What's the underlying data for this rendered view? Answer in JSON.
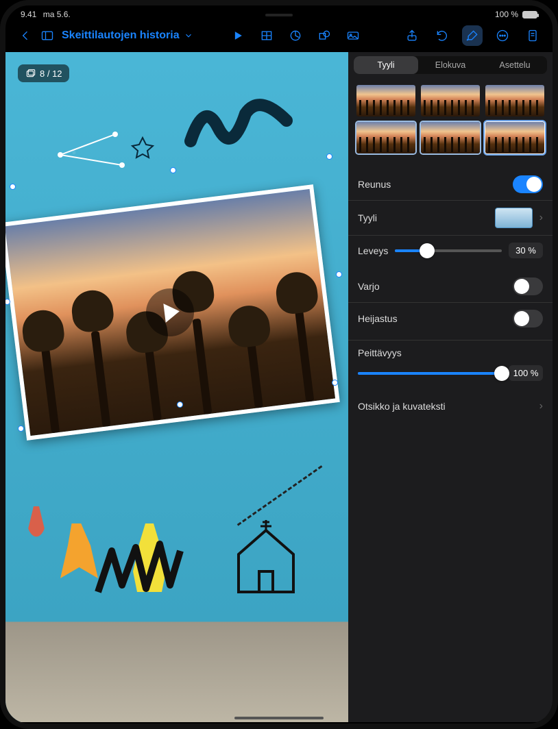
{
  "status": {
    "time": "9.41",
    "date": "ma 5.6.",
    "battery_pct": "100 %"
  },
  "document": {
    "title": "Skeittilautojen historia"
  },
  "canvas": {
    "slide_counter": "8 / 12"
  },
  "sidebar": {
    "segments": {
      "style": "Tyyli",
      "movie": "Elokuva",
      "layout": "Asettelu"
    },
    "border_label": "Reunus",
    "style_label": "Tyyli",
    "width_label": "Leveys",
    "width_value": "30 %",
    "shadow_label": "Varjo",
    "reflection_label": "Heijastus",
    "opacity_label": "Peittävyys",
    "opacity_value": "100 %",
    "caption_label": "Otsikko ja kuvateksti"
  }
}
